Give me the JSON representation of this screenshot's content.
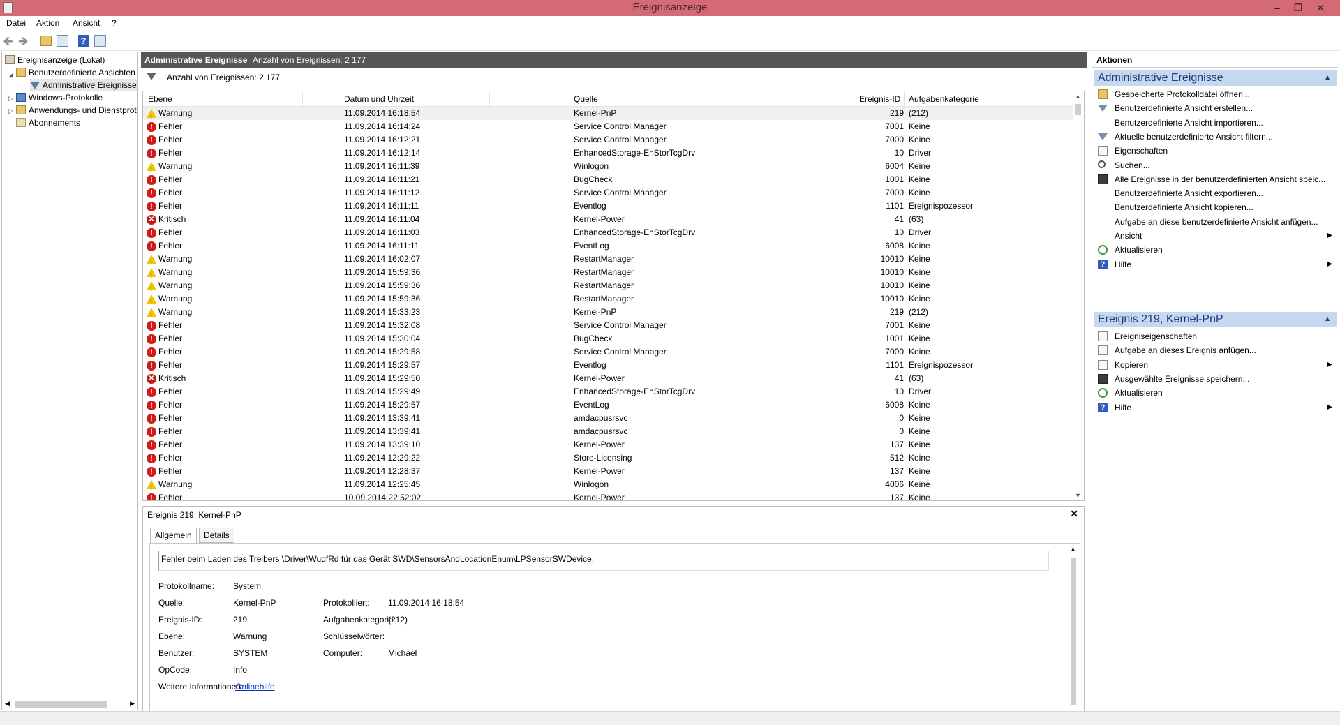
{
  "window": {
    "title": "Ereignisanzeige"
  },
  "menu": [
    "Datei",
    "Aktion",
    "Ansicht",
    "?"
  ],
  "tree": {
    "root": "Ereignisanzeige (Lokal)",
    "custom_views": "Benutzerdefinierte Ansichten",
    "admin_events": "Administrative Ereignisse",
    "windows_logs": "Windows-Protokolle",
    "app_logs": "Anwendungs- und Dienstprotokolle",
    "subscriptions": "Abonnements"
  },
  "panel": {
    "title": "Administrative Ereignisse",
    "count_header": "Anzahl von Ereignissen: 2 177",
    "count_filter": "Anzahl von Ereignissen: 2 177"
  },
  "columns": [
    "Ebene",
    "Datum und Uhrzeit",
    "Quelle",
    "Ereignis-ID",
    "Aufgabenkategorie"
  ],
  "events": [
    {
      "level": "Warnung",
      "type": "warn",
      "date": "11.09.2014 16:18:54",
      "source": "Kernel-PnP",
      "id": "219",
      "category": "(212)"
    },
    {
      "level": "Fehler",
      "type": "err",
      "date": "11.09.2014 16:14:24",
      "source": "Service Control Manager",
      "id": "7001",
      "category": "Keine"
    },
    {
      "level": "Fehler",
      "type": "err",
      "date": "11.09.2014 16:12:21",
      "source": "Service Control Manager",
      "id": "7000",
      "category": "Keine"
    },
    {
      "level": "Fehler",
      "type": "err",
      "date": "11.09.2014 16:12:14",
      "source": "EnhancedStorage-EhStorTcgDrv",
      "id": "10",
      "category": "Driver"
    },
    {
      "level": "Warnung",
      "type": "warn",
      "date": "11.09.2014 16:11:39",
      "source": "Winlogon",
      "id": "6004",
      "category": "Keine"
    },
    {
      "level": "Fehler",
      "type": "err",
      "date": "11.09.2014 16:11:21",
      "source": "BugCheck",
      "id": "1001",
      "category": "Keine"
    },
    {
      "level": "Fehler",
      "type": "err",
      "date": "11.09.2014 16:11:12",
      "source": "Service Control Manager",
      "id": "7000",
      "category": "Keine"
    },
    {
      "level": "Fehler",
      "type": "err",
      "date": "11.09.2014 16:11:11",
      "source": "Eventlog",
      "id": "1101",
      "category": "Ereignispozessor"
    },
    {
      "level": "Kritisch",
      "type": "crit",
      "date": "11.09.2014 16:11:04",
      "source": "Kernel-Power",
      "id": "41",
      "category": "(63)"
    },
    {
      "level": "Fehler",
      "type": "err",
      "date": "11.09.2014 16:11:03",
      "source": "EnhancedStorage-EhStorTcgDrv",
      "id": "10",
      "category": "Driver"
    },
    {
      "level": "Fehler",
      "type": "err",
      "date": "11.09.2014 16:11:11",
      "source": "EventLog",
      "id": "6008",
      "category": "Keine"
    },
    {
      "level": "Warnung",
      "type": "warn",
      "date": "11.09.2014 16:02:07",
      "source": "RestartManager",
      "id": "10010",
      "category": "Keine"
    },
    {
      "level": "Warnung",
      "type": "warn",
      "date": "11.09.2014 15:59:36",
      "source": "RestartManager",
      "id": "10010",
      "category": "Keine"
    },
    {
      "level": "Warnung",
      "type": "warn",
      "date": "11.09.2014 15:59:36",
      "source": "RestartManager",
      "id": "10010",
      "category": "Keine"
    },
    {
      "level": "Warnung",
      "type": "warn",
      "date": "11.09.2014 15:59:36",
      "source": "RestartManager",
      "id": "10010",
      "category": "Keine"
    },
    {
      "level": "Warnung",
      "type": "warn",
      "date": "11.09.2014 15:33:23",
      "source": "Kernel-PnP",
      "id": "219",
      "category": "(212)"
    },
    {
      "level": "Fehler",
      "type": "err",
      "date": "11.09.2014 15:32:08",
      "source": "Service Control Manager",
      "id": "7001",
      "category": "Keine"
    },
    {
      "level": "Fehler",
      "type": "err",
      "date": "11.09.2014 15:30:04",
      "source": "BugCheck",
      "id": "1001",
      "category": "Keine"
    },
    {
      "level": "Fehler",
      "type": "err",
      "date": "11.09.2014 15:29:58",
      "source": "Service Control Manager",
      "id": "7000",
      "category": "Keine"
    },
    {
      "level": "Fehler",
      "type": "err",
      "date": "11.09.2014 15:29:57",
      "source": "Eventlog",
      "id": "1101",
      "category": "Ereignispozessor"
    },
    {
      "level": "Kritisch",
      "type": "crit",
      "date": "11.09.2014 15:29:50",
      "source": "Kernel-Power",
      "id": "41",
      "category": "(63)"
    },
    {
      "level": "Fehler",
      "type": "err",
      "date": "11.09.2014 15:29:49",
      "source": "EnhancedStorage-EhStorTcgDrv",
      "id": "10",
      "category": "Driver"
    },
    {
      "level": "Fehler",
      "type": "err",
      "date": "11.09.2014 15:29:57",
      "source": "EventLog",
      "id": "6008",
      "category": "Keine"
    },
    {
      "level": "Fehler",
      "type": "err",
      "date": "11.09.2014 13:39:41",
      "source": "amdacpusrsvc",
      "id": "0",
      "category": "Keine"
    },
    {
      "level": "Fehler",
      "type": "err",
      "date": "11.09.2014 13:39:41",
      "source": "amdacpusrsvc",
      "id": "0",
      "category": "Keine"
    },
    {
      "level": "Fehler",
      "type": "err",
      "date": "11.09.2014 13:39:10",
      "source": "Kernel-Power",
      "id": "137",
      "category": "Keine"
    },
    {
      "level": "Fehler",
      "type": "err",
      "date": "11.09.2014 12:29:22",
      "source": "Store-Licensing",
      "id": "512",
      "category": "Keine"
    },
    {
      "level": "Fehler",
      "type": "err",
      "date": "11.09.2014 12:28:37",
      "source": "Kernel-Power",
      "id": "137",
      "category": "Keine"
    },
    {
      "level": "Warnung",
      "type": "warn",
      "date": "11.09.2014 12:25:45",
      "source": "Winlogon",
      "id": "4006",
      "category": "Keine"
    },
    {
      "level": "Fehler",
      "type": "err",
      "date": "10.09.2014 22:52:02",
      "source": "Kernel-Power",
      "id": "137",
      "category": "Keine"
    }
  ],
  "detail": {
    "title": "Ereignis 219, Kernel-PnP",
    "tabs": [
      "Allgemein",
      "Details"
    ],
    "message": "Fehler beim Laden des Treibers \\Driver\\WudfRd für das Gerät SWD\\SensorsAndLocationEnum\\LPSensorSWDevice.",
    "labels": {
      "log_name": "Protokollname:",
      "source": "Quelle:",
      "event_id": "Ereignis-ID:",
      "level": "Ebene:",
      "user": "Benutzer:",
      "opcode": "OpCode:",
      "more_info": "Weitere Informationen:",
      "logged": "Protokolliert:",
      "task_category": "Aufgabenkategorie:",
      "keywords": "Schlüsselwörter:",
      "computer": "Computer:"
    },
    "values": {
      "log_name": "System",
      "source": "Kernel-PnP",
      "event_id": "219",
      "level": "Warnung",
      "user": "SYSTEM",
      "opcode": "Info",
      "more_info_link": "Onlinehilfe",
      "logged": "11.09.2014 16:18:54",
      "task_category": "(212)",
      "keywords": "",
      "computer": "Michael"
    }
  },
  "actions": {
    "header": "Aktionen",
    "section1": "Administrative Ereignisse",
    "items1": [
      {
        "label": "Gespeicherte Protokolldatei öffnen...",
        "icon": "folder",
        "name": "open-saved-log"
      },
      {
        "label": "Benutzerdefinierte Ansicht erstellen...",
        "icon": "funnel",
        "name": "create-custom-view"
      },
      {
        "label": "Benutzerdefinierte Ansicht importieren...",
        "icon": "none",
        "name": "import-custom-view"
      },
      {
        "label": "Aktuelle benutzerdefinierte Ansicht filtern...",
        "icon": "funnel",
        "name": "filter-current-view"
      },
      {
        "label": "Eigenschaften",
        "icon": "doc",
        "name": "properties"
      },
      {
        "label": "Suchen...",
        "icon": "search",
        "name": "find"
      },
      {
        "label": "Alle Ereignisse in der benutzerdefinierten Ansicht speic...",
        "icon": "disk",
        "name": "save-all-events"
      },
      {
        "label": "Benutzerdefinierte Ansicht exportieren...",
        "icon": "none",
        "name": "export-custom-view"
      },
      {
        "label": "Benutzerdefinierte Ansicht kopieren...",
        "icon": "none",
        "name": "copy-custom-view"
      },
      {
        "label": "Aufgabe an diese benutzerdefinierte Ansicht anfügen...",
        "icon": "none",
        "name": "attach-task-view"
      },
      {
        "label": "Ansicht",
        "icon": "none",
        "name": "view-submenu",
        "submenu": true
      },
      {
        "label": "Aktualisieren",
        "icon": "refresh",
        "name": "refresh"
      },
      {
        "label": "Hilfe",
        "icon": "help",
        "name": "help-submenu",
        "submenu": true
      }
    ],
    "section2": "Ereignis 219, Kernel-PnP",
    "items2": [
      {
        "label": "Ereigniseigenschaften",
        "icon": "doc",
        "name": "event-properties"
      },
      {
        "label": "Aufgabe an dieses Ereignis anfügen...",
        "icon": "doc",
        "name": "attach-task-event"
      },
      {
        "label": "Kopieren",
        "icon": "doc",
        "name": "copy-submenu",
        "submenu": true
      },
      {
        "label": "Ausgewählte Ereignisse speichern...",
        "icon": "disk",
        "name": "save-selected"
      },
      {
        "label": "Aktualisieren",
        "icon": "refresh",
        "name": "refresh-2"
      },
      {
        "label": "Hilfe",
        "icon": "help",
        "name": "help-submenu-2",
        "submenu": true
      }
    ]
  }
}
